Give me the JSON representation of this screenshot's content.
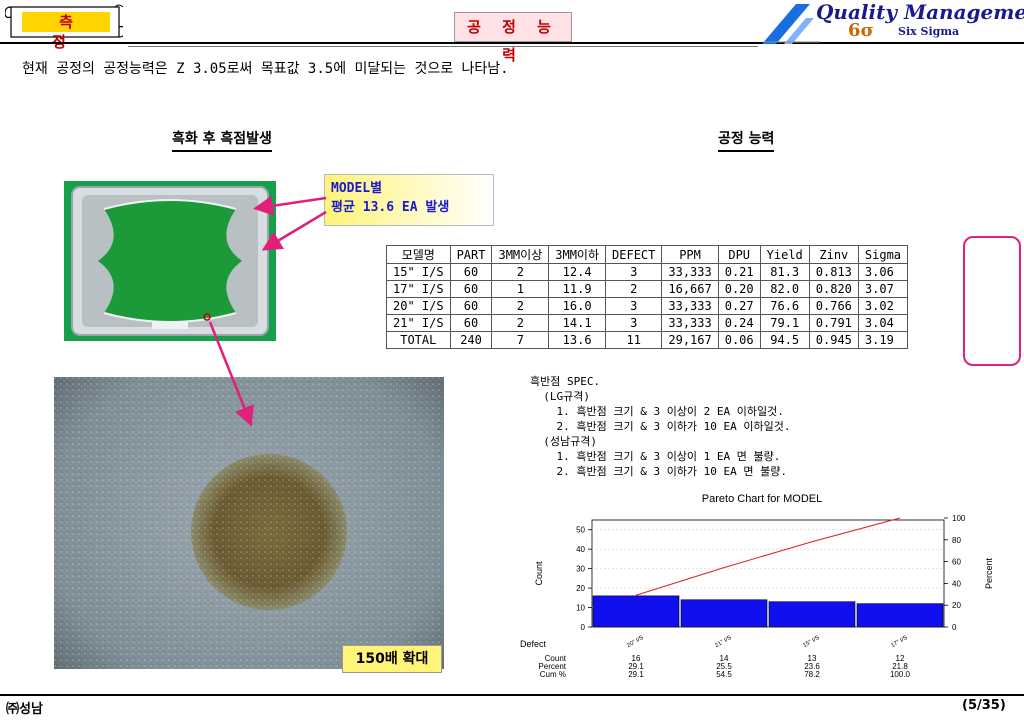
{
  "header": {
    "section_label": "측 정",
    "title": "공 정 능 력",
    "logo_main": "Quality Management",
    "logo_sigma": "6σ",
    "logo_sub": "Six Sigma"
  },
  "summary": "현재 공정의 공정능력은 Z 3.05로써 목표값 3.5에 미달되는 것으로 나타남.",
  "left_section": {
    "heading": "흑화 후 흑점발생",
    "callout_line1": "MODEL별",
    "callout_line2": "평균 13.6 EA 발생",
    "magnification_label": "150배 확대"
  },
  "right_section": {
    "heading": "공정 능력"
  },
  "capability_table": {
    "headers": [
      "모델명",
      "PART",
      "3MM이상",
      "3MM이하",
      "DEFECT",
      "PPM",
      "DPU",
      "Yield",
      "Zinv",
      "Sigma"
    ],
    "rows": [
      [
        "15\" I/S",
        "60",
        "2",
        "12.4",
        "3",
        "33,333",
        "0.21",
        "81.3",
        "0.813",
        "3.06"
      ],
      [
        "17\" I/S",
        "60",
        "1",
        "11.9",
        "2",
        "16,667",
        "0.20",
        "82.0",
        "0.820",
        "3.07"
      ],
      [
        "20\" I/S",
        "60",
        "2",
        "16.0",
        "3",
        "33,333",
        "0.27",
        "76.6",
        "0.766",
        "3.02"
      ],
      [
        "21\" I/S",
        "60",
        "2",
        "14.1",
        "3",
        "33,333",
        "0.24",
        "79.1",
        "0.791",
        "3.04"
      ],
      [
        "TOTAL",
        "240",
        "7",
        "13.6",
        "11",
        "29,167",
        "0.06",
        "94.5",
        "0.945",
        "3.19"
      ]
    ]
  },
  "spec_text": {
    "l1": "흑반점 SPEC.",
    "l2": "  (LG규격)",
    "l3": "    1. 흑반점 크기 & 3 이상이 2 EA 이하일것.",
    "l4": "    2. 흑반점 크기 & 3 이하가 10 EA 이하일것.",
    "l5": "  (성남규격)",
    "l6": "    1. 흑반점 크기 & 3 이상이 1 EA 면 불량.",
    "l7": "    2. 흑반점 크기 & 3 이하가 10 EA 면 불량."
  },
  "chart_data": {
    "type": "bar",
    "title": "Pareto Chart for MODEL",
    "categories": [
      "20\" I/S",
      "21\" I/S",
      "15\" I/S",
      "17\" I/S"
    ],
    "values": [
      16,
      14,
      13,
      12
    ],
    "percent": [
      29.1,
      25.5,
      23.6,
      21.8
    ],
    "cum_percent": [
      29.1,
      54.5,
      78.2,
      100.0
    ],
    "ylabel": "Count",
    "y2label": "Percent",
    "ylim": [
      0,
      55
    ],
    "y2lim": [
      0,
      100
    ],
    "yticks": [
      0,
      10,
      20,
      30,
      40,
      50
    ],
    "y2ticks": [
      0,
      20,
      40,
      60,
      80,
      100
    ],
    "row_labels": [
      "Defect",
      "Count",
      "Percent",
      "Cum %"
    ],
    "bar_color": "#1010ee",
    "line_color": "#e02020"
  },
  "footer": {
    "company": "㈜성남",
    "page": "(5/35)"
  }
}
